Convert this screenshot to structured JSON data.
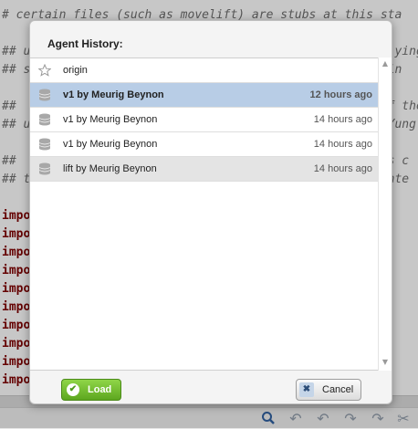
{
  "editor": {
    "lines": [
      {
        "text": "# certain files (such as movelift) are stubs at this sta",
        "kind": "comment"
      },
      {
        "text": "",
        "kind": "blank"
      },
      {
        "text": "## u                                                   ying",
        "kind": "comment"
      },
      {
        "text": "## s                                                  in",
        "kind": "comment"
      },
      {
        "text": "",
        "kind": "blank"
      },
      {
        "text": "##                                                    f the",
        "kind": "comment"
      },
      {
        "text": "## u                                                  Yung",
        "kind": "comment"
      },
      {
        "text": "",
        "kind": "blank"
      },
      {
        "text": "##                                                   es c",
        "kind": "comment"
      },
      {
        "text": "## t                                                 unte",
        "kind": "comment"
      },
      {
        "text": "",
        "kind": "blank"
      },
      {
        "text": "impo",
        "kind": "kw"
      },
      {
        "text": "impo",
        "kind": "kw"
      },
      {
        "text": "impo",
        "kind": "kw"
      },
      {
        "text": "impo",
        "kind": "kw"
      },
      {
        "text": "impo",
        "kind": "kw"
      },
      {
        "text": "impo",
        "kind": "kw"
      },
      {
        "text": "impo",
        "kind": "kw"
      },
      {
        "text": "impo",
        "kind": "kw"
      },
      {
        "text": "impo",
        "kind": "kw"
      },
      {
        "text": "impo",
        "kind": "kw"
      }
    ]
  },
  "toolbar_icons": [
    "search-icon",
    "undo-icon",
    "undo-alt-icon",
    "redo-icon",
    "redo-alt-icon",
    "cut-icon"
  ],
  "dialog": {
    "title": "Agent History:",
    "rows": [
      {
        "icon": "star-icon",
        "label": "origin",
        "time": "",
        "state": "normal"
      },
      {
        "icon": "database-icon",
        "label": "v1 by Meurig Beynon",
        "time": "12 hours ago",
        "state": "selected"
      },
      {
        "icon": "database-icon",
        "label": "v1 by Meurig Beynon",
        "time": "14 hours ago",
        "state": "normal"
      },
      {
        "icon": "database-icon",
        "label": "v1 by Meurig Beynon",
        "time": "14 hours ago",
        "state": "normal"
      },
      {
        "icon": "database-icon",
        "label": "lift by Meurig Beynon",
        "time": "14 hours ago",
        "state": "hover"
      }
    ],
    "load_label": "Load",
    "cancel_label": "Cancel"
  },
  "colors": {
    "selected_row": "#b8cde6",
    "hover_row": "#e4e4e4",
    "load_button": "#6cb52a",
    "keyword": "#7a0000"
  }
}
